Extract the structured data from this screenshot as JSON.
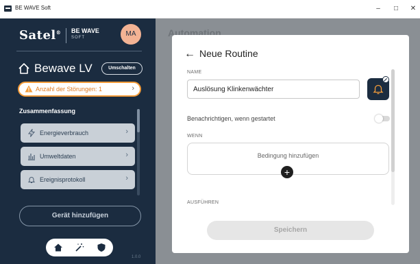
{
  "window": {
    "title": "BE WAVE Soft",
    "controls": {
      "minimize": "–",
      "maximize": "□",
      "close": "✕"
    }
  },
  "sidebar": {
    "logo_brand": "Satel",
    "logo_mark": "®",
    "logo_product": "BE WAVE",
    "logo_product_sub": "SOFT",
    "avatar_initials": "MA",
    "site_name": "Bewave LV",
    "switch_label": "Umschalten",
    "fault_banner": "Anzahl der Störungen: 1",
    "section_title": "Zusammenfassung",
    "items": [
      {
        "label": "Energieverbrauch",
        "icon": "bolt-icon"
      },
      {
        "label": "Umweltdaten",
        "icon": "chart-icon"
      },
      {
        "label": "Ereignisprotokoll",
        "icon": "bell-icon"
      }
    ],
    "add_device_label": "Gerät hinzufügen",
    "bottom_nav": [
      "home-icon",
      "magic-wand-icon",
      "shield-icon"
    ],
    "version": "1.0.0"
  },
  "background": {
    "heading": "Automation"
  },
  "modal": {
    "title": "Neue Routine",
    "name_label": "NAME",
    "name_value": "Auslösung Klinkenwächter",
    "notify_label": "Benachrichtigen, wenn gestartet",
    "notify_enabled": false,
    "when_label": "WENN",
    "add_condition_label": "Bedingung hinzufügen",
    "execute_label": "AUSFÜHREN",
    "save_label": "Speichern"
  },
  "colors": {
    "sidebar_bg": "#1b2c40",
    "accent_orange": "#f39c3a",
    "avatar_bg": "#f3b394",
    "nav_item_bg": "#c9d0d7",
    "overlay_bg": "#8a8f94"
  }
}
